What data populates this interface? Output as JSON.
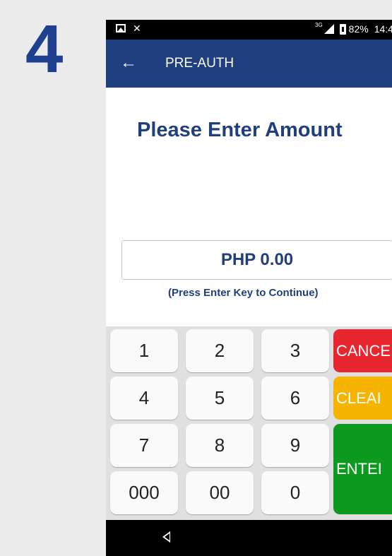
{
  "step_number": "4",
  "status_bar": {
    "network_label": "3G",
    "battery_percent": "82%",
    "time": "14:4"
  },
  "app_bar": {
    "back_glyph": "←",
    "title": "PRE-AUTH"
  },
  "prompt": "Please Enter Amount",
  "amount_display": "PHP 0.00",
  "hint": "(Press Enter Key to Continue)",
  "keypad": {
    "digits": [
      "1",
      "2",
      "3",
      "4",
      "5",
      "6",
      "7",
      "8",
      "9",
      "000",
      "00",
      "0"
    ],
    "cancel_label": "CANCE",
    "clear_label": "CLEAI",
    "enter_label": "ENTEI"
  },
  "colors": {
    "primary": "#1f3f7f",
    "cancel": "#e8262f",
    "clear": "#f6b400",
    "enter": "#0b9a1f"
  }
}
